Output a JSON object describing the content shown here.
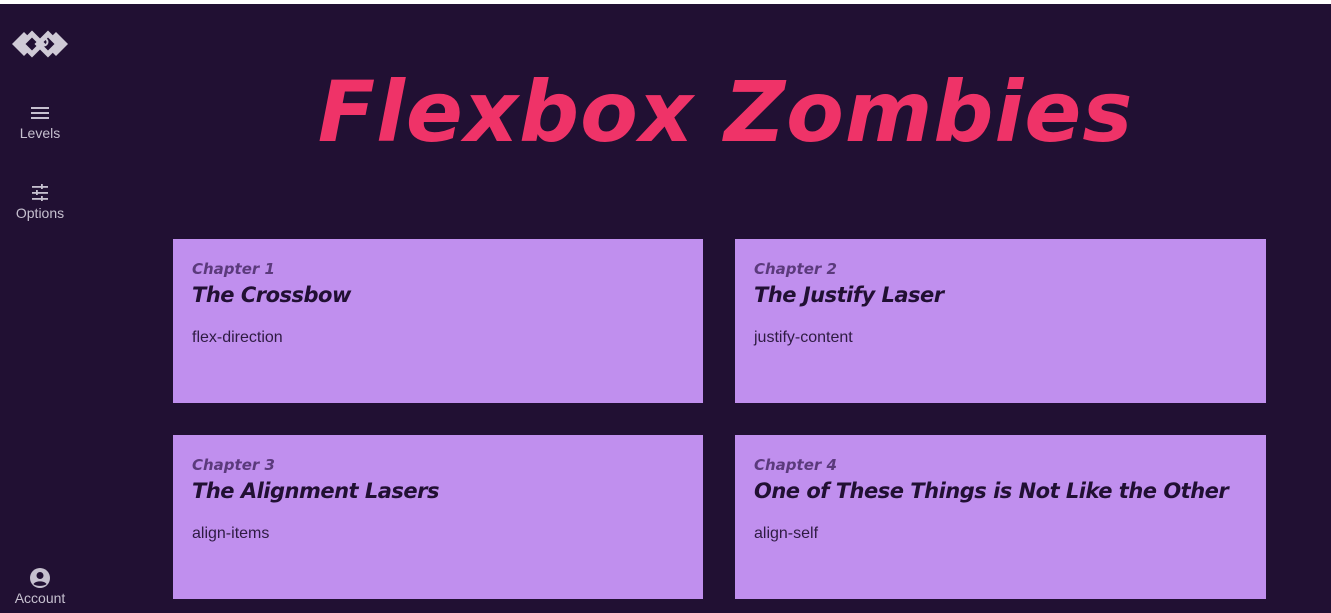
{
  "app": {
    "title": "Flexbox Zombies"
  },
  "sidebar": {
    "logo_icon": "geometric-diamond-logo",
    "items": [
      {
        "label": "Levels",
        "icon": "hamburger-menu-icon"
      },
      {
        "label": "Options",
        "icon": "sliders-icon"
      }
    ],
    "account": {
      "label": "Account",
      "icon": "account-circle-icon"
    }
  },
  "chapters": [
    {
      "chapter": "Chapter 1",
      "title": "The Crossbow",
      "property": "flex-direction"
    },
    {
      "chapter": "Chapter 2",
      "title": "The Justify Laser",
      "property": "justify-content"
    },
    {
      "chapter": "Chapter 3",
      "title": "The Alignment Lasers",
      "property": "align-items"
    },
    {
      "chapter": "Chapter 4",
      "title": "One of These Things is Not Like the Other",
      "property": "align-self"
    }
  ],
  "colors": {
    "background": "#211033",
    "title": "#ef3368",
    "card": "#c08fee",
    "nav_text": "#c6c0cf"
  }
}
